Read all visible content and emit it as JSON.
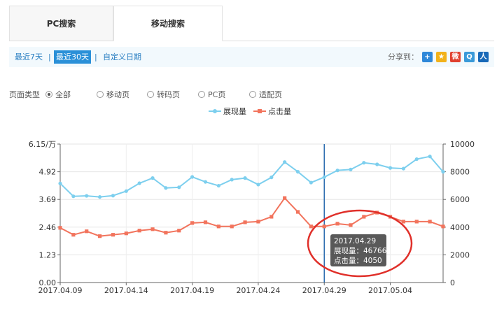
{
  "tabs": [
    {
      "label": "PC搜索",
      "active": false
    },
    {
      "label": "移动搜索",
      "active": true
    }
  ],
  "date_filter": {
    "options": [
      "最近7天",
      "最近30天",
      "自定义日期"
    ],
    "active": "最近30天",
    "separator": "|"
  },
  "share": {
    "label": "分享到：",
    "icons": [
      {
        "name": "plus-share-icon",
        "glyph": "+",
        "color": "#2f88d9"
      },
      {
        "name": "qzone-icon",
        "glyph": "★",
        "color": "#f2b21b"
      },
      {
        "name": "weibo-icon",
        "glyph": "微",
        "color": "#e0402f"
      },
      {
        "name": "tencent-weibo-icon",
        "glyph": "Q",
        "color": "#3a9ad9"
      },
      {
        "name": "renren-icon",
        "glyph": "人",
        "color": "#1869b8"
      }
    ]
  },
  "page_type": {
    "label": "页面类型",
    "options": [
      {
        "label": "全部",
        "checked": true
      },
      {
        "label": "移动页",
        "checked": false
      },
      {
        "label": "转码页",
        "checked": false
      },
      {
        "label": "PC页",
        "checked": false
      },
      {
        "label": "适配页",
        "checked": false
      }
    ]
  },
  "legend": {
    "series1": "展现量",
    "series2": "点击量"
  },
  "tooltip": {
    "date": "2017.04.29",
    "line1": "展现量：46766",
    "line2": "点击量：4050"
  },
  "colors": {
    "impressions": "#7dcfee",
    "clicks": "#f2745d",
    "crosshair": "#2b6cb0",
    "highlight_circle": "#e0302a"
  },
  "chart_data": {
    "type": "line",
    "x": [
      "2017.04.09",
      "2017.04.10",
      "2017.04.11",
      "2017.04.12",
      "2017.04.13",
      "2017.04.14",
      "2017.04.15",
      "2017.04.16",
      "2017.04.17",
      "2017.04.18",
      "2017.04.19",
      "2017.04.20",
      "2017.04.21",
      "2017.04.22",
      "2017.04.23",
      "2017.04.24",
      "2017.04.25",
      "2017.04.26",
      "2017.04.27",
      "2017.04.28",
      "2017.04.29",
      "2017.04.30",
      "2017.05.01",
      "2017.05.02",
      "2017.05.03",
      "2017.05.04",
      "2017.05.05",
      "2017.05.06",
      "2017.05.07",
      "2017.05.08"
    ],
    "x_tick_labels": [
      "2017.04.09",
      "2017.04.14",
      "2017.04.19",
      "2017.04.24",
      "2017.04.29",
      "2017.05.04"
    ],
    "series": [
      {
        "name": "展现量",
        "axis": "left",
        "values": [
          4.4,
          3.83,
          3.85,
          3.8,
          3.86,
          4.06,
          4.41,
          4.64,
          4.2,
          4.23,
          4.69,
          4.47,
          4.3,
          4.57,
          4.64,
          4.35,
          4.67,
          5.35,
          4.92,
          4.44,
          4.68,
          4.98,
          5.02,
          5.32,
          5.25,
          5.09,
          5.06,
          5.48,
          5.6,
          4.92
        ]
      },
      {
        "name": "点击量",
        "axis": "right",
        "values": [
          3950,
          3450,
          3700,
          3350,
          3450,
          3550,
          3750,
          3850,
          3600,
          3750,
          4300,
          4350,
          4050,
          4050,
          4350,
          4400,
          4750,
          6100,
          5100,
          4050,
          4050,
          4250,
          4150,
          4750,
          5050,
          4750,
          4400,
          4400,
          4400,
          4050
        ]
      }
    ],
    "y_left": {
      "unit_label": "6.15/万",
      "ticks": [
        "0.00",
        "1.23",
        "2.46",
        "3.69",
        "4.92",
        "6.15"
      ],
      "range": [
        0,
        6.15
      ]
    },
    "y_right": {
      "ticks": [
        "0",
        "2000",
        "4000",
        "6000",
        "8000",
        "10000"
      ],
      "range": [
        0,
        10000
      ]
    },
    "highlight_index": 20,
    "grid": true
  }
}
